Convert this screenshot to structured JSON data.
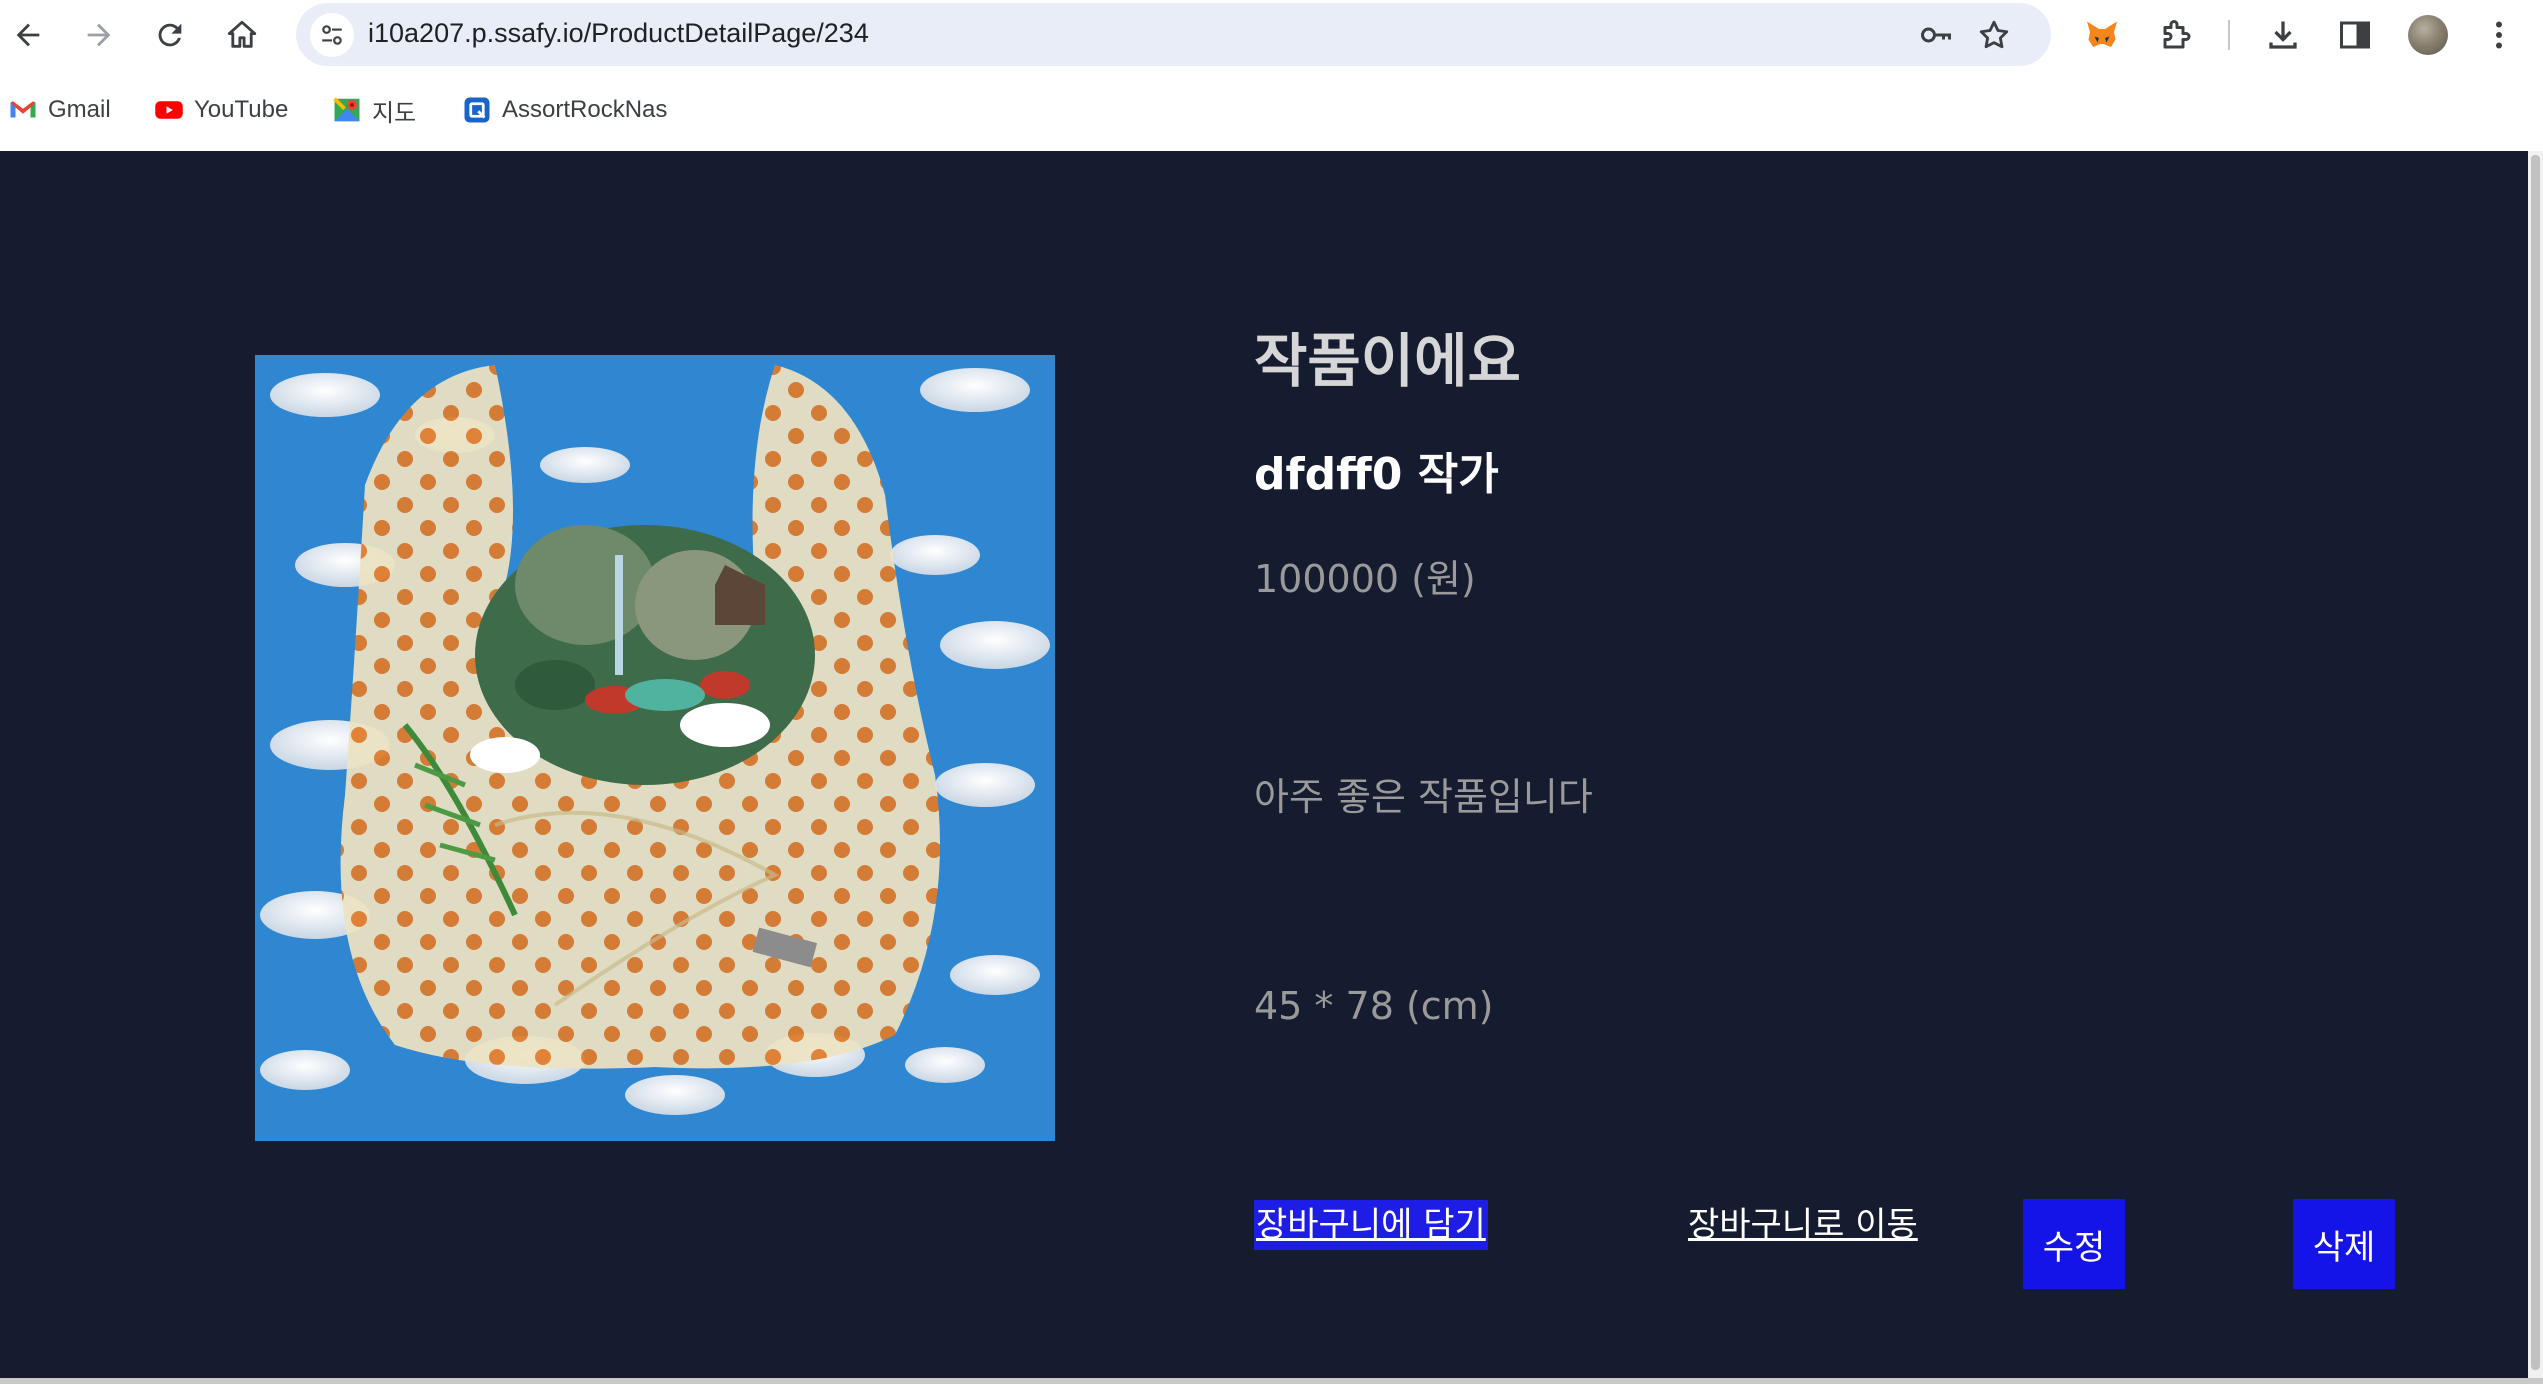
{
  "browser": {
    "url": "i10a207.p.ssafy.io/ProductDetailPage/234",
    "bookmarks": [
      {
        "label": "Gmail",
        "icon": "gmail-icon"
      },
      {
        "label": "YouTube",
        "icon": "youtube-icon"
      },
      {
        "label": "지도",
        "icon": "maps-icon"
      },
      {
        "label": "AssortRockNas",
        "icon": "nas-icon"
      }
    ]
  },
  "product": {
    "title": "작품이에요",
    "artist": "dfdff0 작가",
    "price": "100000 (원)",
    "description": "아주 좋은 작품입니다",
    "size": "45 * 78 (cm)"
  },
  "actions": {
    "add_to_cart": "장바구니에 담기",
    "go_to_cart": "장바구니로 이동",
    "edit": "수정",
    "delete": "삭제"
  },
  "colors": {
    "page_background": "#151c2f",
    "action_blue": "#1414e8"
  }
}
